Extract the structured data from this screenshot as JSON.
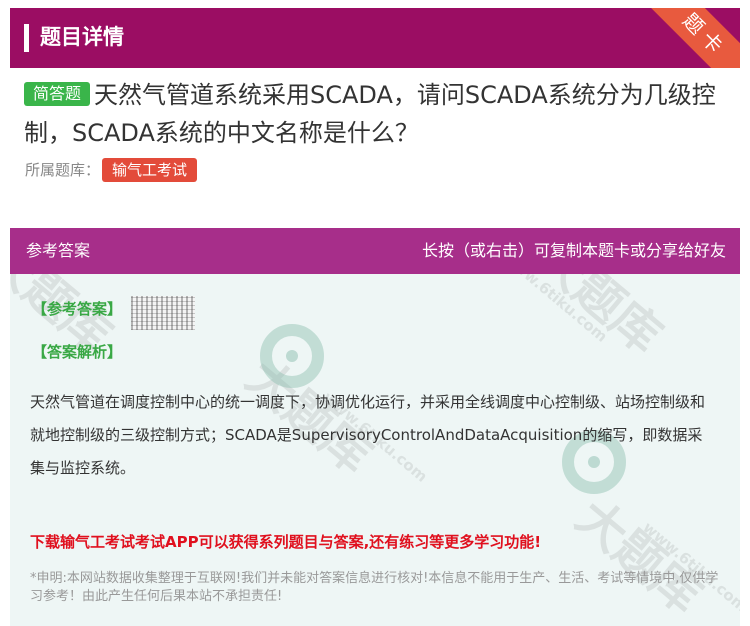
{
  "header": {
    "title": "题目详情",
    "corner_ribbon": "题卡"
  },
  "question": {
    "type_badge": "简答题",
    "text": "天然气管道系统采用SCADA，请问SCADA系统分为几级控制，SCADA系统的中文名称是什么？",
    "bank_label": "所属题库：",
    "bank_name": "输气工考试"
  },
  "answer": {
    "header_left": "参考答案",
    "header_right": "长按（或右击）可复制本题卡或分享给好友",
    "ref_label": "【参考答案】",
    "analysis_label": "【答案解析】",
    "analysis_text": "天然气管道在调度控制中心的统一调度下，协调优化运行，并采用全线调度中心控制级、站场控制级和就地控制级的三级控制方式；SCADA是SupervisoryControlAndDataAcquisition的缩写，即数据采集与监控系统。",
    "promo": "下载输气工考试考试APP可以获得系列题目与答案,还有练习等更多学习功能!",
    "disclaimer": "*申明:本网站数据收集整理于互联网!我们并未能对答案信息进行核对!本信息不能用于生产、生活、考试等情境中,仅供学习参考！由此产生任何后果本站不承担责任!"
  },
  "watermark": {
    "brand": "大题库",
    "domain": "www.6tiku.com"
  },
  "colors": {
    "header": "#9b0d63",
    "answer_header": "#a72e8a",
    "badge_green": "#3ab54a",
    "badge_red": "#e34b3a",
    "promo_red": "#e0101e"
  }
}
